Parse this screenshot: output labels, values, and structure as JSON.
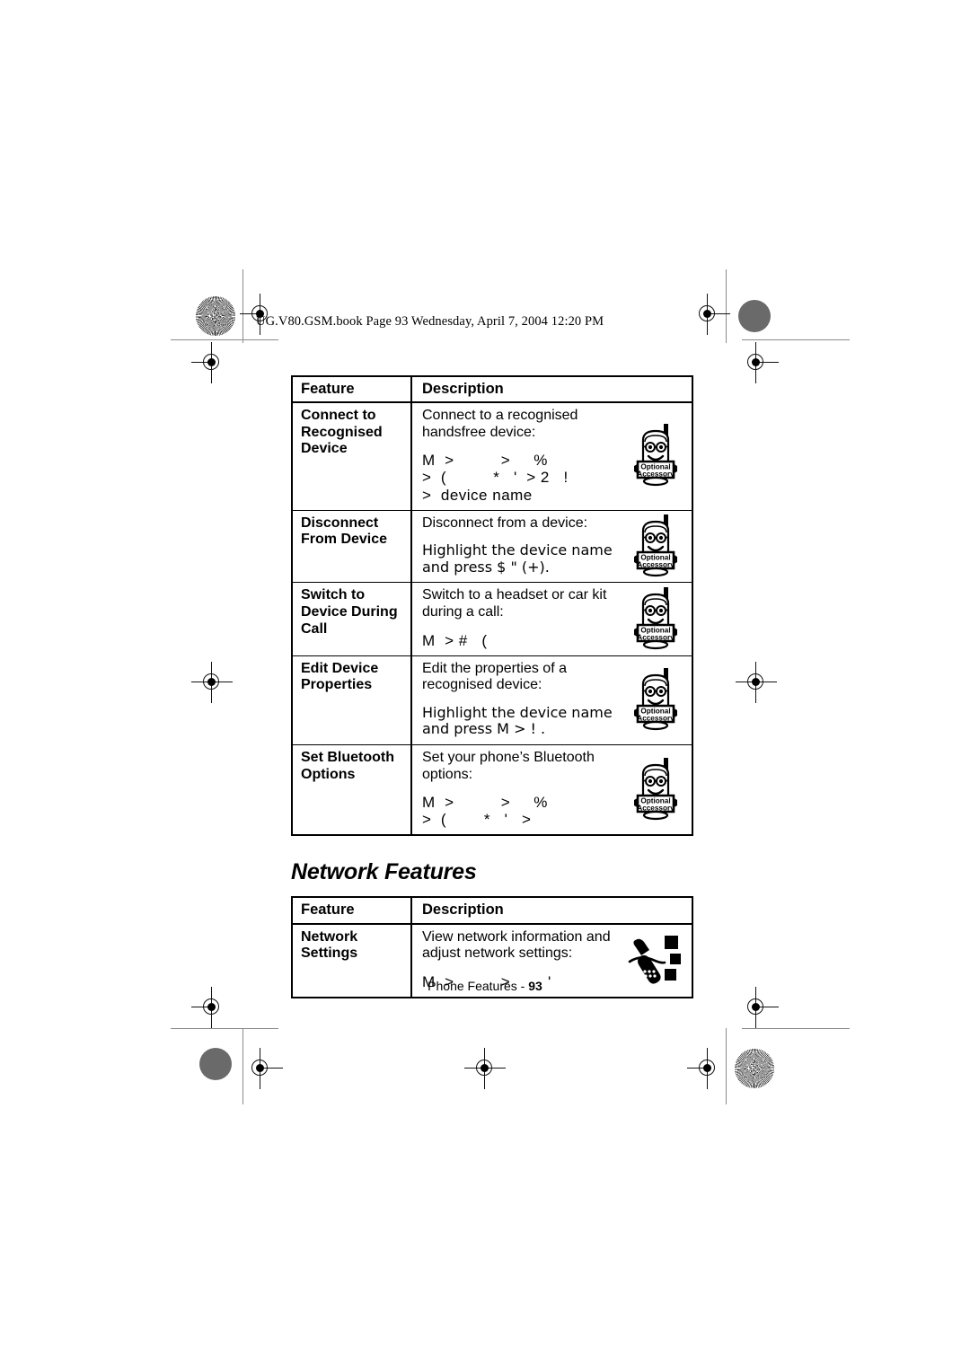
{
  "page": {
    "header_line": "UG.V80.GSM.book  Page 93  Wednesday, April 7, 2004  12:20 PM",
    "footer_label": "Phone Features - ",
    "footer_page": "93"
  },
  "bluetooth_table": {
    "columns": [
      "Feature",
      "Description"
    ],
    "rows": [
      {
        "feature": "Connect to Recognised Device",
        "desc_lines": [
          "Connect to a recognised handsfree device:"
        ],
        "nav_path_lines": [
          "M  >          >     %",
          ">  (          *   '  > 2   !",
          ">  device name"
        ],
        "icon": "optional-accessory-icon"
      },
      {
        "feature": "Disconnect From Device",
        "desc_lines": [
          "Disconnect from a device:",
          "Highlight the device name and press $  \"  (+)."
        ],
        "nav_path_lines": [],
        "icon": "optional-accessory-icon"
      },
      {
        "feature": "Switch to Device During Call",
        "desc_lines": [
          "Switch to a headset or car kit during a call:"
        ],
        "nav_path_lines": [
          "M  > #   ("
        ],
        "icon": "optional-accessory-icon"
      },
      {
        "feature": "Edit Device Properties",
        "desc_lines": [
          "Edit the properties of a recognised device:",
          "Highlight the device name and press M  >  !  ."
        ],
        "nav_path_lines": [],
        "icon": "optional-accessory-icon"
      },
      {
        "feature": "Set Bluetooth Options",
        "desc_lines": [
          "Set your phone’s Bluetooth options:"
        ],
        "nav_path_lines": [
          "M  >          >     %",
          ">  (        *   '   >"
        ],
        "icon": "optional-accessory-icon"
      }
    ]
  },
  "network_section": {
    "heading": "Network Features",
    "table": {
      "columns": [
        "Feature",
        "Description"
      ],
      "rows": [
        {
          "feature": "Network Settings",
          "desc_lines": [
            "View network information and adjust network settings:"
          ],
          "nav_path_lines": [
            "M  >          >        '"
          ],
          "icon": "network-phone-icon"
        }
      ]
    }
  },
  "icon_labels": {
    "optional_line1": "Optional",
    "optional_line2": "Accessory"
  },
  "colors": {
    "ink": "#000000",
    "paper": "#ffffff",
    "mark_gray": "#6a6a6a"
  }
}
